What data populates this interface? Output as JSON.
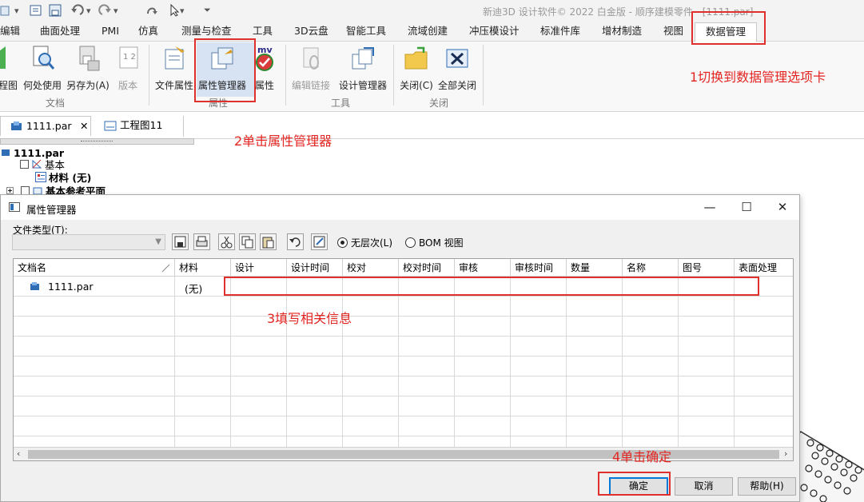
{
  "app_title": "新迪3D 设计软件© 2022 白金版 - 顺序建模零件 - [1111.par]",
  "tabs": [
    {
      "label": "编辑"
    },
    {
      "label": "曲面处理"
    },
    {
      "label": "PMI"
    },
    {
      "label": "仿真"
    },
    {
      "label": "测量与检查"
    },
    {
      "label": "工具"
    },
    {
      "label": "3D云盘"
    },
    {
      "label": "智能工具"
    },
    {
      "label": "流域创建"
    },
    {
      "label": "冲压模设计"
    },
    {
      "label": "标准件库"
    },
    {
      "label": "增材制造"
    },
    {
      "label": "视图"
    },
    {
      "label": "数据管理"
    }
  ],
  "active_tab": "数据管理",
  "ribbon": {
    "buttons": {
      "drawing": "程图",
      "where_used": "何处使用",
      "save_as": "另存为(A)",
      "version": "版本",
      "file_props": "文件属性",
      "prop_manager": "属性管理器",
      "props": "属性",
      "edit_links": "编辑链接",
      "design_manager": "设计管理器",
      "close": "关闭(C)",
      "close_all": "全部关闭"
    },
    "groups": {
      "document": "文档",
      "properties": "属性",
      "tools": "工具",
      "close": "关闭"
    },
    "mv_label": "mv",
    "version_icon_text": "1 2"
  },
  "doc_tabs": [
    {
      "label": "1111.par"
    },
    {
      "label": "工程图11"
    }
  ],
  "tree": {
    "root": "1111.par",
    "items": [
      {
        "label": "基本"
      },
      {
        "label": "材料 (无)"
      },
      {
        "label": "基本参考平面"
      }
    ]
  },
  "dialog": {
    "title": "属性管理器",
    "file_type_label": "文件类型(T):",
    "radio_no_hierarchy": "无层次(L)",
    "radio_bom": "BOM 视图",
    "columns": [
      "文档名",
      "材料",
      "设计",
      "设计时间",
      "校对",
      "校对时间",
      "审核",
      "审核时间",
      "数量",
      "名称",
      "图号",
      "表面处理"
    ],
    "rows": [
      {
        "doc_name": "1111.par",
        "material": "(无)"
      }
    ],
    "buttons": {
      "ok": "确定",
      "cancel": "取消",
      "help": "帮助(H)"
    }
  },
  "annotations": {
    "step1": "1切换到数据管理选项卡",
    "step2": "2单击属性管理器",
    "step3": "3填写相关信息",
    "step4": "4单击确定"
  },
  "colors": {
    "annotation": "#e32521",
    "accent": "#0078d7",
    "ribbon_selected": "#d7e3f3"
  }
}
